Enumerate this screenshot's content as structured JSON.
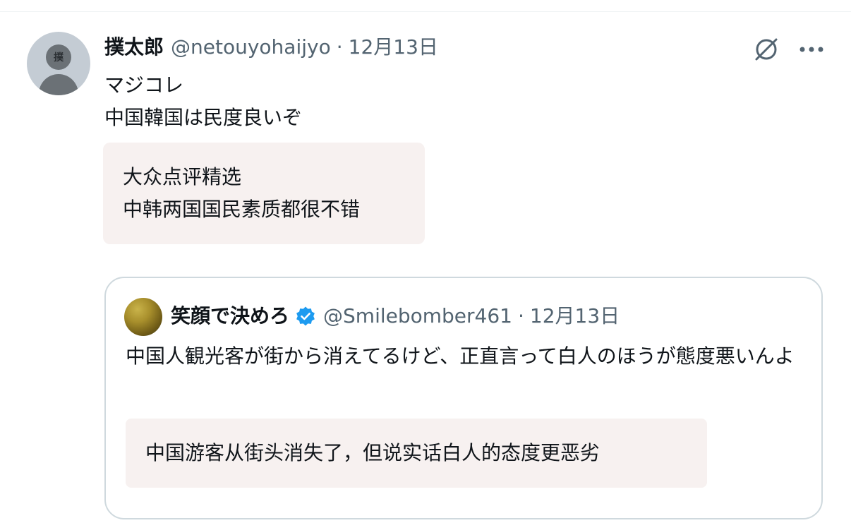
{
  "post": {
    "author_name": "撲太郎",
    "avatar_char": "撲",
    "handle": "@netouyohaijyo",
    "separator": "·",
    "date": "12月13日",
    "text_lines": [
      "マジコレ",
      "中国韓国は民度良いぞ"
    ],
    "translation_lines": [
      "大众点评精选",
      "中韩两国国民素质都很不错"
    ]
  },
  "quote": {
    "author_name": "笑顔で決めろ",
    "handle": "@Smilebomber461",
    "separator": "·",
    "date": "12月13日",
    "text": "中国人観光客が街から消えてるけど、正直言って白人のほうが態度悪いんよ",
    "translation": "中国游客从街头消失了，但说实话白人的态度更恶劣"
  },
  "icons": {
    "grok": "grok-icon",
    "more": "more-icon",
    "verified": "verified-badge-icon"
  },
  "colors": {
    "text": "#0f1419",
    "secondary": "#536471",
    "verified": "#1d9bf0",
    "translation_bg": "#f7f1f0",
    "border": "#cfd9de"
  }
}
